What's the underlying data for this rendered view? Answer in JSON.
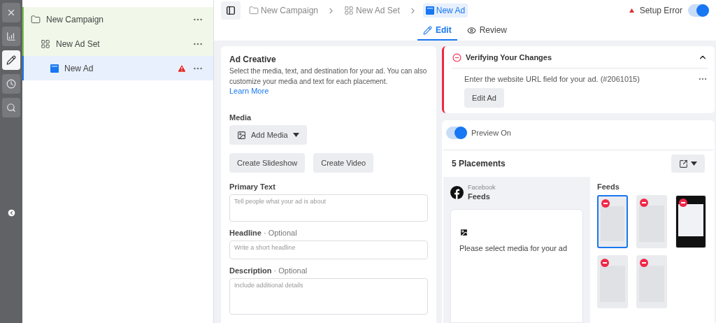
{
  "rail": {
    "items": [
      {
        "kind": "close",
        "selected": false
      },
      {
        "kind": "chart",
        "selected": false
      },
      {
        "kind": "edit",
        "selected": true
      },
      {
        "kind": "history",
        "selected": false
      },
      {
        "kind": "search",
        "selected": false
      }
    ]
  },
  "tree": [
    {
      "kind": "campaign",
      "label": "New Campaign",
      "selected": false,
      "warning": false,
      "children": [
        {
          "kind": "adset",
          "label": "New Ad Set",
          "selected": false,
          "warning": false,
          "children": [
            {
              "kind": "ad",
              "label": "New Ad",
              "selected": true,
              "warning": true
            }
          ]
        }
      ]
    }
  ],
  "breadcrumbs": [
    {
      "kind": "campaign",
      "label": "New Campaign",
      "selected": false
    },
    {
      "kind": "adset",
      "label": "New Ad Set",
      "selected": false
    },
    {
      "kind": "ad",
      "label": "New Ad",
      "selected": true
    }
  ],
  "status": {
    "label": "Setup Error",
    "on": true
  },
  "tabs": [
    {
      "kind": "edit",
      "label": "Edit",
      "selected": true
    },
    {
      "kind": "review",
      "label": "Review",
      "selected": false
    }
  ],
  "creative": {
    "title": "Ad Creative",
    "description": "Select the media, text, and destination for your ad. You can also customize your media and text for each placement.",
    "link": "Learn More",
    "media_label": "Media",
    "add_media": "Add Media",
    "buttons": [
      "Create Slideshow",
      "Create Video"
    ],
    "fields": [
      {
        "label": "Primary Text",
        "placeholder": "Tell people what your ad is about",
        "kind": "multiline"
      },
      {
        "label": "Headline",
        "optional": "· Optional",
        "placeholder": "Write a short headline",
        "kind": "line"
      },
      {
        "label": "Description",
        "optional": "· Optional",
        "placeholder": "Include additional details",
        "kind": "multiline"
      }
    ]
  },
  "error_card": {
    "title": "Verifying Your Changes",
    "expanded": true,
    "message": "Enter the website URL field for your ad. (#2061015)",
    "button": "Edit Ad"
  },
  "preview": {
    "label": "Preview On",
    "on": true,
    "placements_title": "5 Placements",
    "platform": "Facebook",
    "placement": "Feeds",
    "empty_message": "Please select media for your ad",
    "group_title": "Feeds",
    "thumbnails": [
      {
        "kind": "light",
        "selected": true
      },
      {
        "kind": "light",
        "selected": false
      },
      {
        "kind": "dark",
        "selected": false
      },
      {
        "kind": "light",
        "selected": false
      },
      {
        "kind": "light",
        "selected": false
      }
    ]
  }
}
